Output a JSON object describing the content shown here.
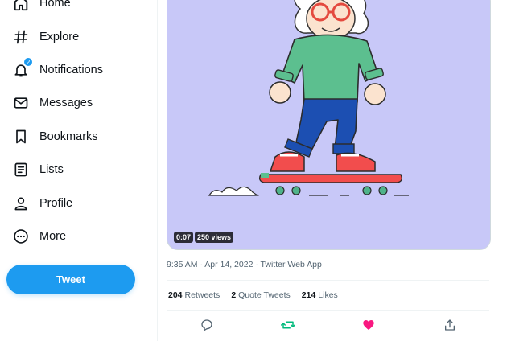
{
  "nav": {
    "home": "Home",
    "explore": "Explore",
    "notifications": "Notifications",
    "notifications_badge": "2",
    "messages": "Messages",
    "bookmarks": "Bookmarks",
    "lists": "Lists",
    "profile": "Profile",
    "more": "More"
  },
  "tweet_button": "Tweet",
  "video": {
    "duration": "0:07",
    "views": "250 views",
    "background_color": "#c8c8f8"
  },
  "tweet_meta": "9:35 AM · Apr 14, 2022 · Twitter Web App",
  "stats": {
    "retweets_count": "204",
    "retweets_label": "Retweets",
    "quotes_count": "2",
    "quotes_label": "Quote Tweets",
    "likes_count": "214",
    "likes_label": "Likes"
  },
  "colors": {
    "accent": "#1d9bf0",
    "retweet": "#00ba7c",
    "like": "#f91880"
  }
}
